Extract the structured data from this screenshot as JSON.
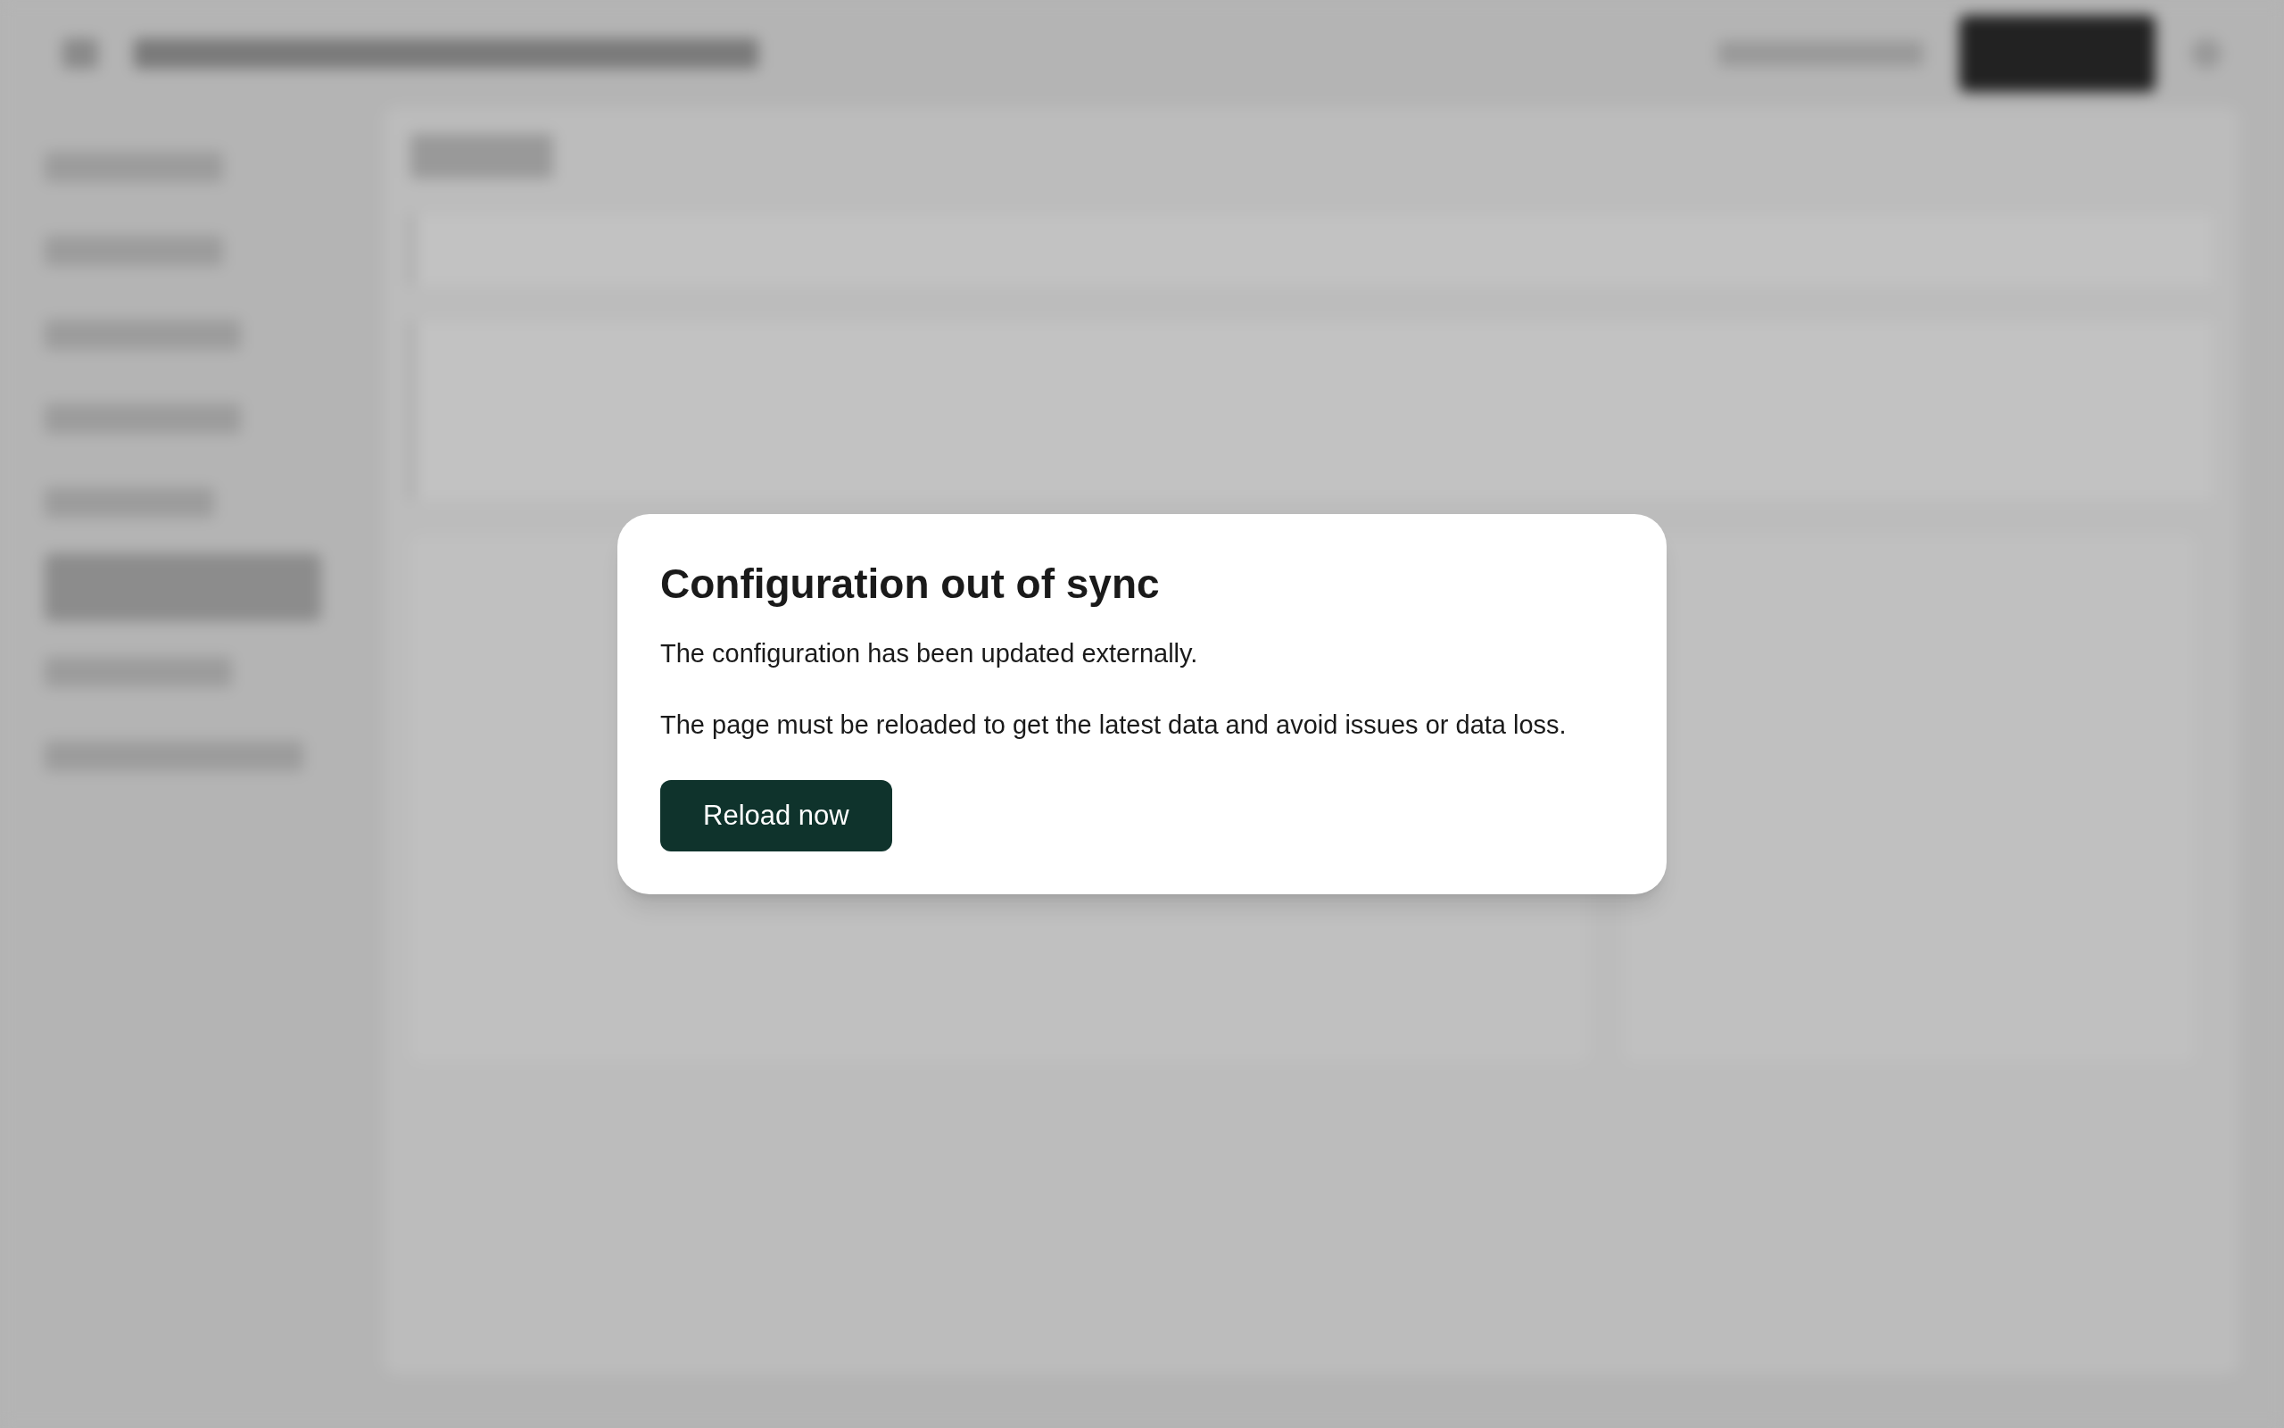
{
  "dialog": {
    "title": "Configuration out of sync",
    "paragraphs": [
      "The configuration has been updated externally.",
      "The page must be reloaded to get the latest data and avoid issues or data loss."
    ],
    "button": "Reload now"
  }
}
